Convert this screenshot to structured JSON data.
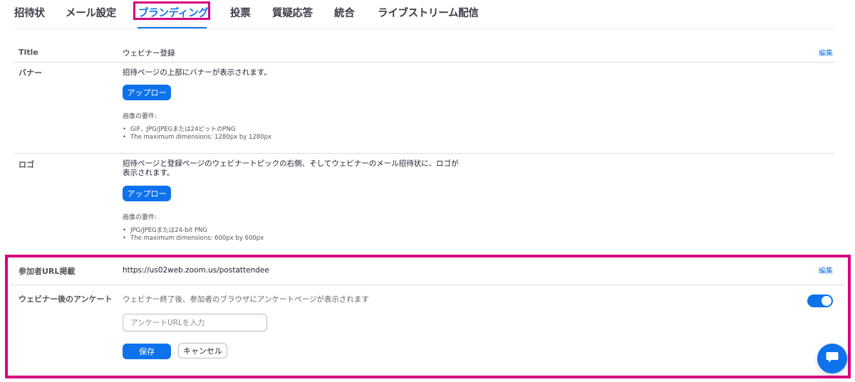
{
  "tabs": [
    {
      "label": "招待状"
    },
    {
      "label": "メール設定"
    },
    {
      "label": "ブランディング",
      "active": true
    },
    {
      "label": "投票"
    },
    {
      "label": "質疑応答"
    },
    {
      "label": "統合"
    },
    {
      "label": "ライブストリーム配信"
    }
  ],
  "title_row": {
    "label": "Title",
    "value": "ウェビナー登録",
    "edit": "編集"
  },
  "banner": {
    "label": "バナー",
    "description": "招待ページの上部にバナーが表示されます。",
    "upload_button": "アップロー",
    "requirements_heading": "画像の要件:",
    "requirements": [
      "GIF、JPG/JPEGまたは24ビットのPNG",
      "The maximum dimensions: 1280px by 1280px"
    ]
  },
  "logo": {
    "label": "ロゴ",
    "description_line1": "招待ページと登録ページのウェビナートピックの右側、そしてウェビナーのメール招待状に、ロゴが",
    "description_line2": "表示されます。",
    "upload_button": "アップロー",
    "requirements_heading": "画像の要件:",
    "requirements": [
      "JPG/JPEGまたは24-bit PNG",
      "The maximum dimensions: 600px by 600px"
    ]
  },
  "attendee_url": {
    "label": "参加者URL掲載",
    "value": "https://us02web.zoom.us/postattendee",
    "edit": "編集"
  },
  "survey": {
    "label": "ウェビナー後のアンケート",
    "description": "ウェビナー終了後、参加者のブラウザにアンケートページが表示されます",
    "toggle_on": true,
    "input_placeholder": "アンケートURLを入力",
    "input_value": "",
    "save_button": "保存",
    "cancel_button": "キャンセル"
  },
  "colors": {
    "accent": "#0e72ed",
    "highlight": "#d6007f"
  },
  "icons": {
    "chat": "chat-bubble-icon"
  }
}
